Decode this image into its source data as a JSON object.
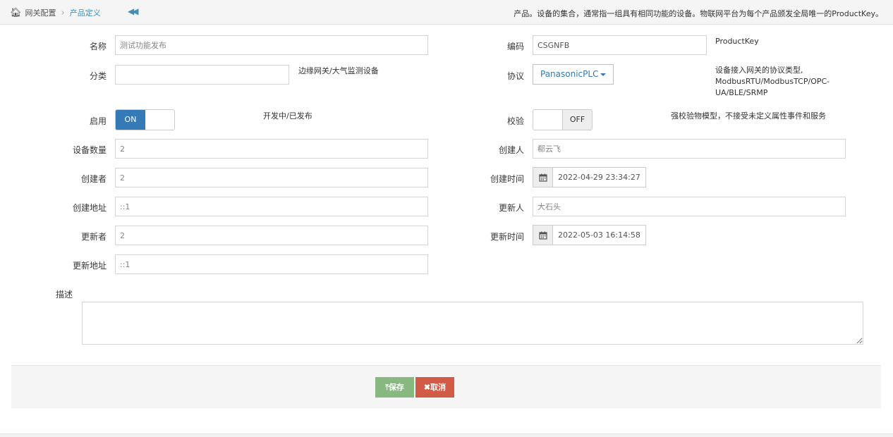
{
  "breadcrumb": {
    "root": "网关配置",
    "current": "产品定义"
  },
  "header_note": "产品。设备的集合，通常指一组具有相同功能的设备。物联网平台为每个产品颁发全局唯一的ProductKey。",
  "left": {
    "name_label": "名称",
    "name_value": "测试功能发布",
    "category_label": "分类",
    "category_value": "",
    "category_hint": "边缘网关/大气监测设备",
    "enable_label": "启用",
    "enable_state": "ON",
    "enable_hint": "开发中/已发布",
    "device_count_label": "设备数量",
    "device_count_value": "2",
    "creator_id_label": "创建者",
    "creator_id_value": "2",
    "create_addr_label": "创建地址",
    "create_addr_value": "::1",
    "updater_id_label": "更新者",
    "updater_id_value": "2",
    "update_addr_label": "更新地址",
    "update_addr_value": "::1"
  },
  "right": {
    "code_label": "编码",
    "code_value": "CSGNFB",
    "code_hint": "ProductKey",
    "protocol_label": "协议",
    "protocol_value": "PanasonicPLC",
    "protocol_hint": [
      "设备接入网关的协议类型,",
      "ModbusRTU/ModbusTCP/OPC-",
      "UA/BLE/SRMP"
    ],
    "verify_label": "校验",
    "verify_state": "OFF",
    "verify_hint": "强校验物模型，不接受未定义属性事件和服务",
    "creator_label": "创建人",
    "creator_value": "郗云飞",
    "create_time_label": "创建时间",
    "create_time_value": "2022-04-29 23:34:27",
    "updater_label": "更新人",
    "updater_value": "大石头",
    "update_time_label": "更新时间",
    "update_time_value": "2022-05-03 16:14:58"
  },
  "description": {
    "label": "描述",
    "value": ""
  },
  "actions": {
    "save_label": "保存",
    "cancel_label": "取消"
  },
  "colors": {
    "primary": "#337ab7",
    "save": "#87b87f",
    "cancel": "#d15b47",
    "link": "#438eb9"
  }
}
